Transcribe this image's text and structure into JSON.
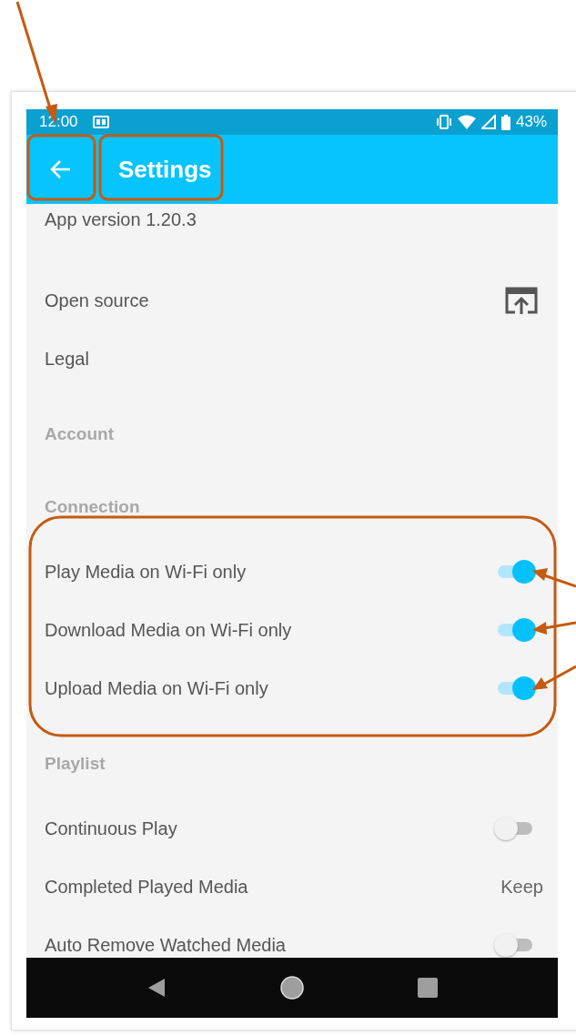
{
  "status_bar": {
    "time": "12:00",
    "battery": "43%"
  },
  "app_bar": {
    "title": "Settings"
  },
  "items": [
    {
      "kind": "info",
      "label": "App version 1.20.3"
    },
    {
      "kind": "link",
      "label": "Open source"
    },
    {
      "kind": "item",
      "label": "Legal"
    },
    {
      "kind": "header",
      "label": "Account"
    },
    {
      "kind": "header",
      "label": "Connection"
    },
    {
      "kind": "toggle",
      "label": "Play Media on Wi-Fi only",
      "on": true
    },
    {
      "kind": "toggle",
      "label": "Download Media on Wi-Fi only",
      "on": true
    },
    {
      "kind": "toggle",
      "label": "Upload Media on Wi-Fi only",
      "on": true
    },
    {
      "kind": "header",
      "label": "Playlist"
    },
    {
      "kind": "toggle",
      "label": "Continuous Play",
      "on": false
    },
    {
      "kind": "value",
      "label": "Completed Played Media",
      "value": "Keep"
    },
    {
      "kind": "toggle",
      "label": "Auto Remove Watched Media",
      "on": false
    }
  ]
}
